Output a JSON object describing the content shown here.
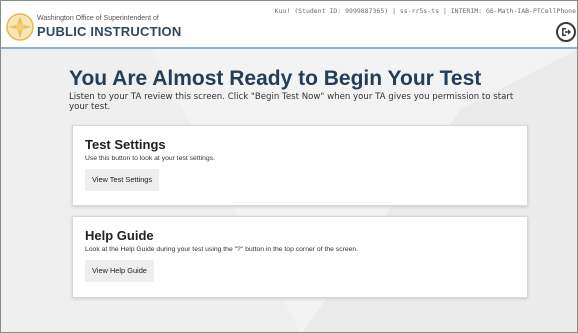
{
  "header": {
    "agency_line1": "Washington Office of Superintendent of",
    "agency_line2": "PUBLIC INSTRUCTION",
    "session_info": "Kuu! (Student ID: 9999887365) | ss-rr5s-ts | INTERIM: G6-Math-IAB-PTCellPhone",
    "exit_icon": "exit-icon"
  },
  "main": {
    "title": "You Are Almost Ready to Begin Your Test",
    "instructions": "Listen to your TA review this screen. Click \"Begin Test Now\" when your TA gives you permission to start your test."
  },
  "cards": {
    "settings": {
      "title": "Test Settings",
      "description": "Use this button to look at your test settings.",
      "button": "View Test Settings"
    },
    "help": {
      "title": "Help Guide",
      "description": "Look at the Help Guide during your test using the \"?\" button in the top corner of the screen.",
      "button": "View Help Guide"
    }
  },
  "colors": {
    "brand_navy": "#253e55",
    "logo_gold": "#e8b84a",
    "header_rule": "#8bb3c4"
  }
}
